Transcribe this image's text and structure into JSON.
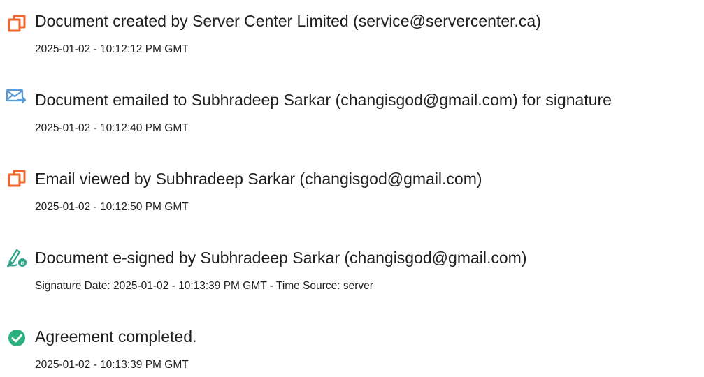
{
  "events": [
    {
      "icon": "document-icon",
      "title": "Document created by Server Center Limited (service@servercenter.ca)",
      "meta": "2025-01-02 - 10:12:12 PM GMT"
    },
    {
      "icon": "email-sent-icon",
      "title": "Document emailed to Subhradeep Sarkar (changisgod@gmail.com) for signature",
      "meta": "2025-01-02 - 10:12:40 PM GMT"
    },
    {
      "icon": "document-icon",
      "title": "Email viewed by Subhradeep Sarkar (changisgod@gmail.com)",
      "meta": "2025-01-02 - 10:12:50 PM GMT"
    },
    {
      "icon": "e-sign-icon",
      "title": "Document e-signed by Subhradeep Sarkar (changisgod@gmail.com)",
      "meta": "Signature Date: 2025-01-02 - 10:13:39 PM GMT - Time Source: server"
    },
    {
      "icon": "check-circle-icon",
      "title": "Agreement completed.",
      "meta": "2025-01-02 - 10:13:39 PM GMT"
    }
  ],
  "colors": {
    "document_icon": "#f0672e",
    "email_icon": "#5b9bd5",
    "sign_icon": "#2fa58c",
    "check_icon": "#2bb07f",
    "text": "#1f1f1f"
  }
}
